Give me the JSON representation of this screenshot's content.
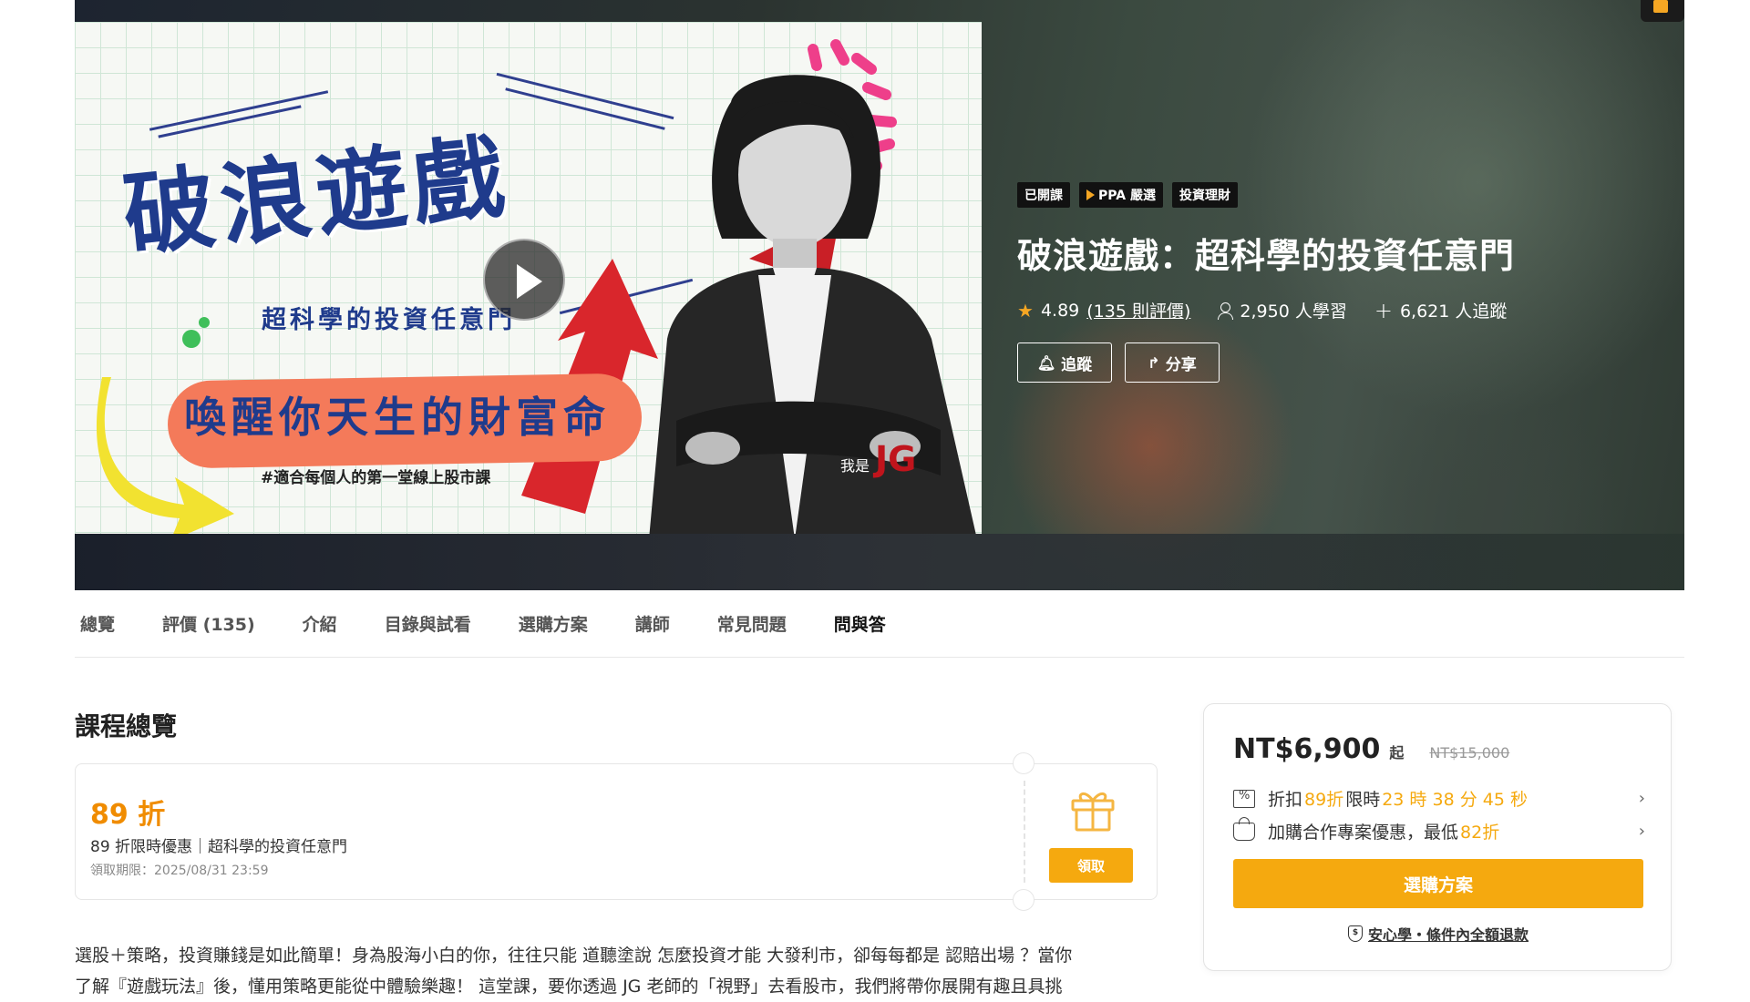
{
  "hero": {
    "cover": {
      "title": "破浪遊戲",
      "subtitle": "超科學的投資任意門",
      "slogan": "喚醒你天生的財富命",
      "hashtag": "#適合每個人的第一堂線上股市課",
      "signature_prefix": "我是",
      "signature": "JG"
    },
    "tags": [
      "已開課",
      "PPA 嚴選",
      "投資理財"
    ],
    "title": "破浪遊戲：超科學的投資任意門",
    "rating": "4.89",
    "reviews_link": "(135 則評價)",
    "learners": "2,950 人學習",
    "followers": "6,621 人追蹤",
    "follow_button": "追蹤",
    "share_button": "分享"
  },
  "tabs": [
    "總覽",
    "評價 (135)",
    "介紹",
    "目錄與試看",
    "選購方案",
    "講師",
    "常見問題",
    "問與答"
  ],
  "main": {
    "section_title": "課程總覽",
    "coupon": {
      "discount": "89 折",
      "description": "89 折限時優惠｜超科學的投資任意門",
      "deadline": "領取期限：2025/08/31 23:59",
      "claim_button": "領取"
    },
    "intro_lines": [
      "選股＋策略，投資賺錢是如此簡單！身為股海小白的你，往往只能 道聽塗說 怎麼投資才能 大發利市，卻每每都是 認賠出場 ？當你",
      "了解『遊戲玩法』後，懂用策略更能從中體驗樂趣！ 這堂課，要你透過 JG 老師的「視野」去看股市，我們將帶你展開有趣且具挑"
    ]
  },
  "price_card": {
    "price": "NT$6,900",
    "price_suffix": "起",
    "original_price": "NT$15,000",
    "promo1": {
      "label": "折扣",
      "rate": "89折",
      "limit_label": "限時",
      "countdown": "23 時 38 分 45 秒"
    },
    "promo2": {
      "label": "加購合作專案優惠，最低",
      "rate": "82折"
    },
    "buy_button": "選購方案",
    "refund_text": "安心學・條件內全額退款"
  },
  "colors": {
    "accent": "#f5a90f",
    "discount_orange": "#f08c00",
    "cover_blue": "#1f3b8c",
    "cover_coral": "#f47a5a"
  }
}
